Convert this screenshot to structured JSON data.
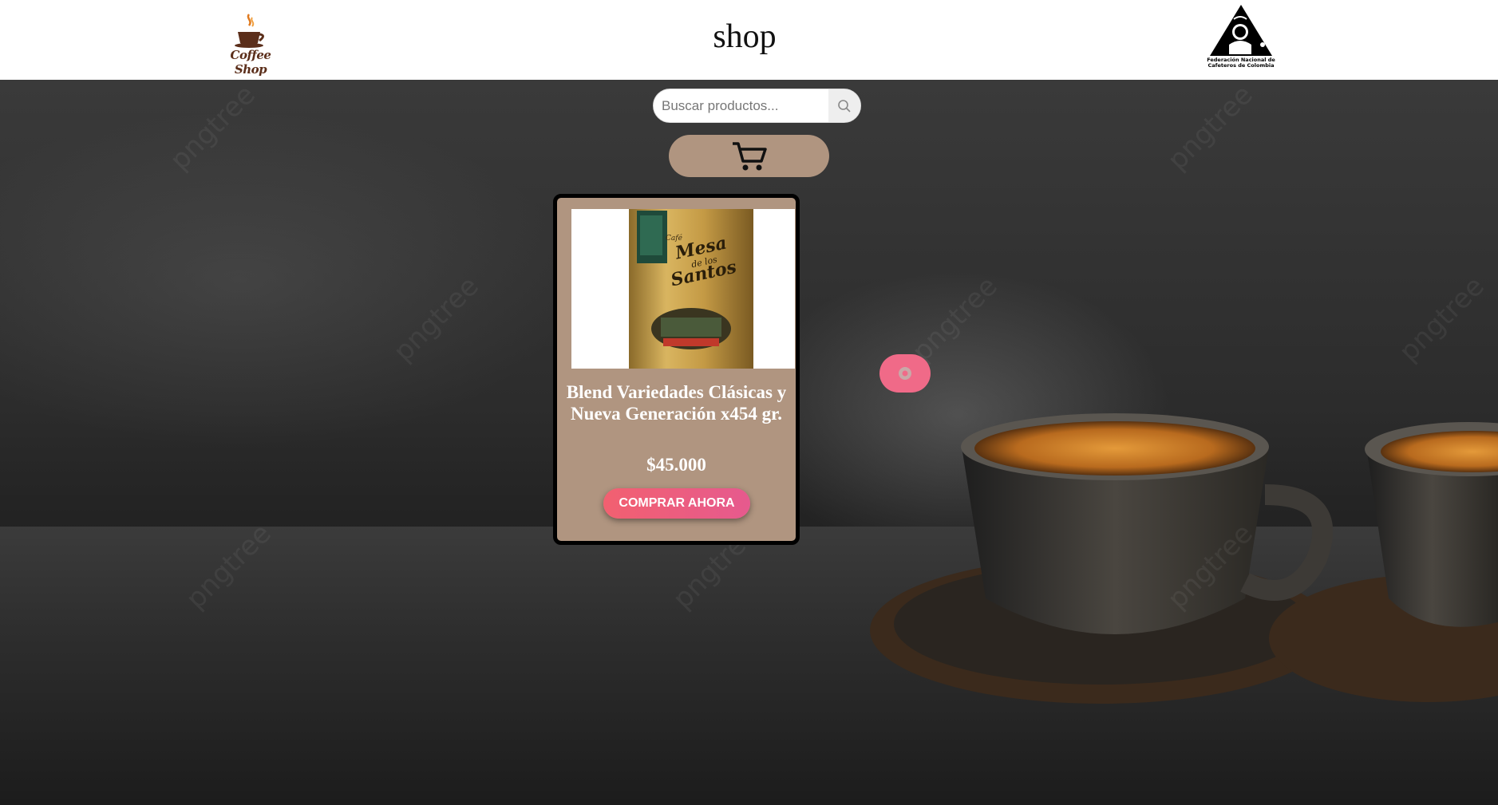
{
  "header": {
    "logo_text": "Coffee Shop",
    "title": "shop",
    "federation_line1": "Federación Nacional de",
    "federation_line2": "Cafeteros de Colombia"
  },
  "search": {
    "placeholder": "Buscar productos...",
    "icon": "search-icon"
  },
  "cart": {
    "icon": "cart-icon"
  },
  "product": {
    "name": "Blend Variedades Clásicas y Nueva Generación x454 gr.",
    "price": "$45.000",
    "buy_label": "COMPRAR AHORA",
    "image_brand_line1": "Mesa",
    "image_brand_line2": "de los",
    "image_brand_line3": "Santos",
    "image_brand_small": "Café"
  },
  "floating_button": {
    "icon": "settings-icon"
  },
  "watermark": "pngtree",
  "colors": {
    "header_bg": "#ffffff",
    "card_bg": "#b09580",
    "button_pink": "#f26070",
    "cart_bg": "#b09580"
  }
}
